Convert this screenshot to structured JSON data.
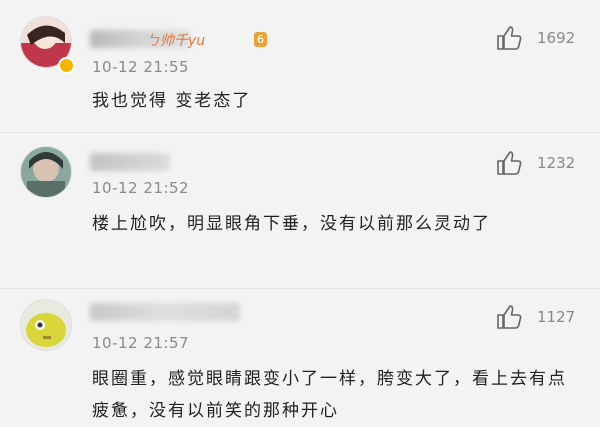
{
  "comments": [
    {
      "name_visible": "ㄅ帅千yu",
      "level_badge": "6",
      "time": "10-12 21:55",
      "text": "我也觉得 变老态了",
      "likes": "1692"
    },
    {
      "time": "10-12 21:52",
      "text": "楼上尬吹，明显眼角下垂，没有以前那么灵动了",
      "likes": "1232"
    },
    {
      "time": "10-12 21:57",
      "text": "眼圈重，感觉眼睛跟变小了一样，胯变大了，看上去有点疲惫，没有以前笑的那种开心",
      "likes": "1127"
    }
  ],
  "colors": {
    "background": "#f3f3f3",
    "text": "#222222",
    "meta": "#8a8a8a",
    "vip_badge": "#f5b300"
  },
  "icons": {
    "like": "thumbs-up-icon",
    "verified": "vip-badge-icon"
  }
}
